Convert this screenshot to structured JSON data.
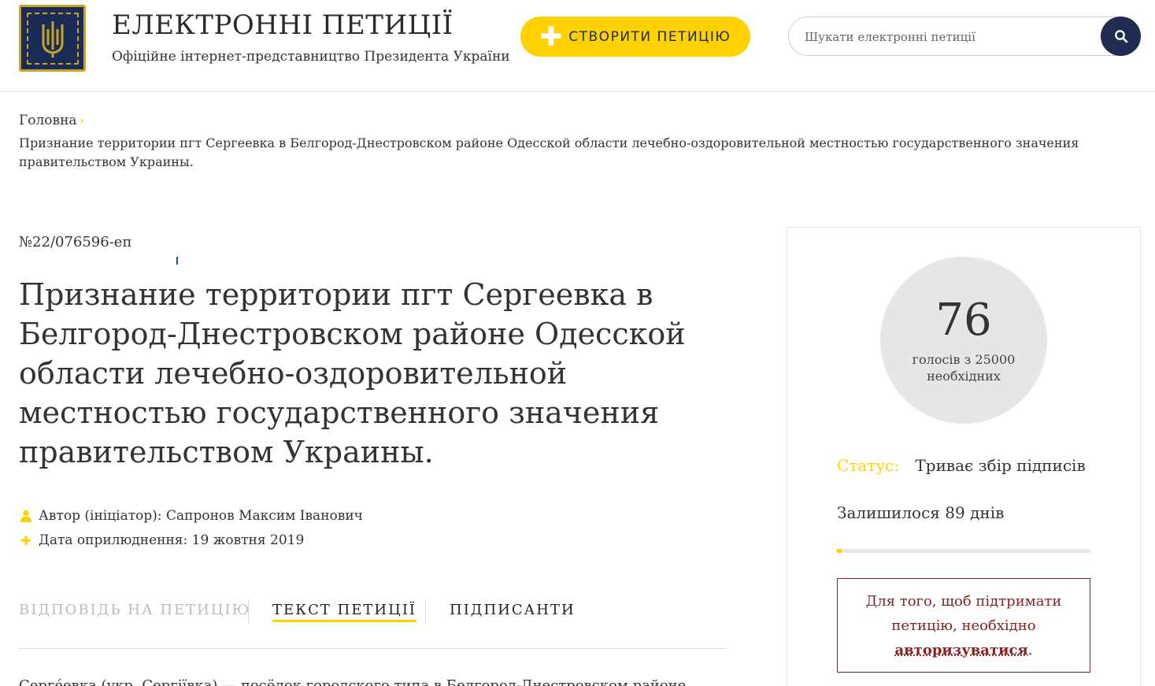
{
  "header": {
    "title": "ЕЛЕКТРОННІ ПЕТИЦІЇ",
    "subtitle": "Офіційне інтернет-представництво Президента України",
    "create_button": "СТВОРИТИ ПЕТИЦІЮ",
    "search_placeholder": "Шукати електронні петиції"
  },
  "breadcrumb": {
    "home": "Головна",
    "current": "Признание территории пгт Сергеевка в Белгород-Днестровском районе Одесской области лечебно-оздоровительной местностью государственного значения правительством Украины."
  },
  "petition": {
    "number": "№22/076596-еп",
    "title": "Признание территории пгт Сергеевка в Белгород-Днестровском районе Одесской области лечебно-оздоровительной местностью государственного значения правительством Украины.",
    "author": "Автор (ініціатор): Сапронов Максим Іванович",
    "date": "Дата оприлюднення: 19 жовтня 2019",
    "body_start": "Серге́евка (укр. Сергіївка) — посёлок городского типа в Белгород-Днестровском районе"
  },
  "tabs": [
    {
      "label": "ВІДПОВІДЬ НА ПЕТИЦІЮ",
      "state": "disabled"
    },
    {
      "label": "ТЕКСТ ПЕТИЦІЇ",
      "state": "active"
    },
    {
      "label": "ПІДПИСАНТИ",
      "state": "normal"
    }
  ],
  "sidebar": {
    "votes": "76",
    "votes_needed_line1": "голосів з 25000",
    "votes_needed_line2": "необхідних",
    "votes_fraction": 0.00304,
    "status_label": "Статус:",
    "status_value": "Триває збір підписів",
    "days_left": "Залишилося 89 днів",
    "auth_text_1": "Для того, щоб підтримати петицію, необхідно",
    "auth_link": "авторизуватися",
    "auth_text_end": "."
  },
  "colors": {
    "accent_yellow": "#ffd100",
    "navy": "#1e2c4f",
    "auth_red": "#8b1f1f"
  }
}
